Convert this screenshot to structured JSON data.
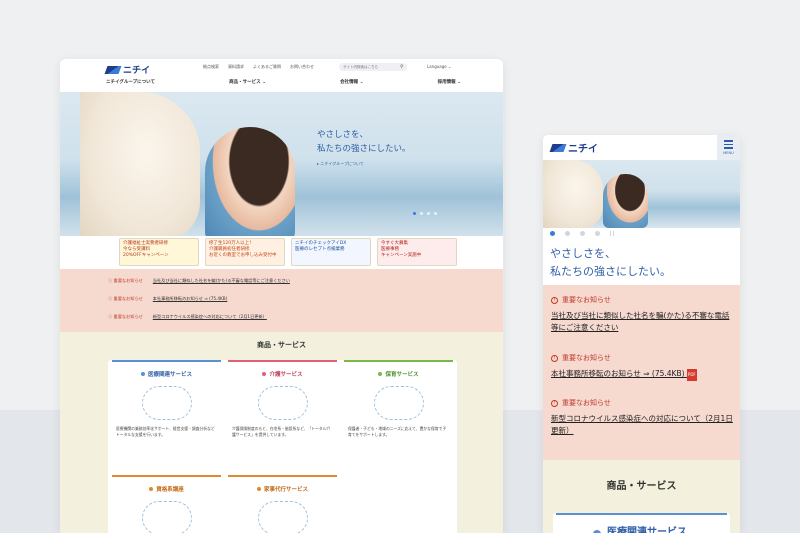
{
  "brand": {
    "logo_text": "ニチイ"
  },
  "desktop": {
    "top_links": [
      "拠点検索",
      "資料請求",
      "よくあるご質問",
      "お問い合わせ"
    ],
    "search_placeholder": "サイト内検索はこちら",
    "language_label": "Language",
    "nav": [
      "ニチイグループについて",
      "商品・サービス",
      "会社情報",
      "採用情報"
    ],
    "hero": {
      "title_line1": "やさしさを、",
      "title_line2": "私たちの強さにしたい。",
      "link": "ニチイグループについて"
    },
    "banners": [
      {
        "line1": "介護福祉士実務者研修",
        "line2": "今なら受講料",
        "line3": "20%OFFキャンペーン"
      },
      {
        "line1": "修了生120万人以上！",
        "line2": "介護職員初任者研修",
        "line3": "お近くの教室でお申し込み受付中"
      },
      {
        "line1": "ニチイのチェックアイDX",
        "line2": "医療のレセプト点検業務",
        "line3": ""
      },
      {
        "line1": "今すぐ大募集",
        "line2": "医療事務",
        "line3": "キャンペーン実施中"
      }
    ],
    "notices": [
      {
        "label": "重要なお知らせ",
        "text": "当社及び当社に類似した社名を騙(かた)る不審な電話等にご注意ください"
      },
      {
        "label": "重要なお知らせ",
        "text": "本社事務所移転のお知らせ ⇒ (75.4KB)"
      },
      {
        "label": "重要なお知らせ",
        "text": "新型コロナウイルス感染症への対応について（2月1日更新）"
      }
    ],
    "products_title": "商品・サービス",
    "cards": [
      {
        "title": "医療関連サービス",
        "color": "#5a8fd6",
        "desc": "医療機関の業務効率化サポート、経営支援・調査分析などトータルな支援を行います。"
      },
      {
        "title": "介護サービス",
        "color": "#e0607a",
        "desc": "介護保険制度のもと、在宅系・施設系など、「トータル介護サービス」を提供しています。"
      },
      {
        "title": "保育サービス",
        "color": "#7ab848",
        "desc": "保護者・子ども・地域のニーズに応えて、豊かな保育で子育てをサポートします。"
      },
      {
        "title": "資格系講座",
        "color": "#e2892d",
        "desc": ""
      },
      {
        "title": "家事代行サービス",
        "color": "#e2892d",
        "desc": ""
      }
    ]
  },
  "mobile": {
    "menu_label": "MENU",
    "hero": {
      "title_line1": "やさしさを、",
      "title_line2": "私たちの強さにしたい。"
    },
    "notices": [
      {
        "label": "重要なお知らせ",
        "text": "当社及び当社に類似した社名を騙(かた)る不審な電話等にご注意ください"
      },
      {
        "label": "重要なお知らせ",
        "text": "本社事務所移転のお知らせ ⇒ (75.4KB)"
      },
      {
        "label": "重要なお知らせ",
        "text": "新型コロナウイルス感染症への対応について（2月1日更新）"
      }
    ],
    "products_title": "商品・サービス",
    "card_title": "医療関連サービス"
  }
}
